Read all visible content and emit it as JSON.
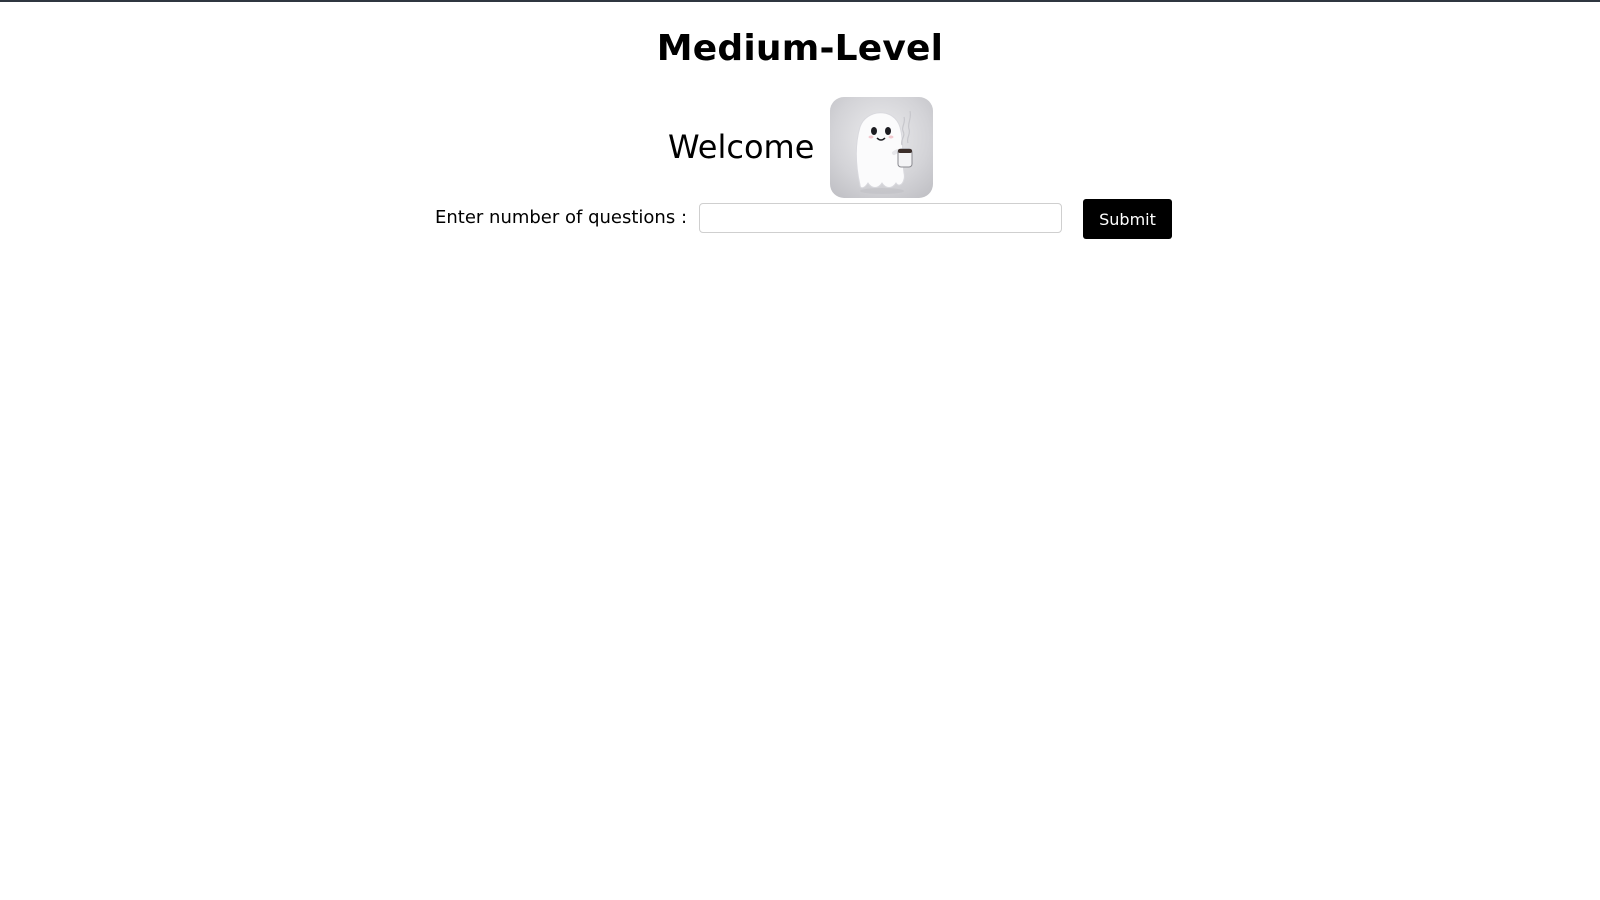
{
  "page": {
    "title": "Medium-Level",
    "welcome": "Welcome"
  },
  "avatar": {
    "icon": "ghost-holding-coffee-icon"
  },
  "form": {
    "label": "Enter number of questions :",
    "input_value": "",
    "input_placeholder": "",
    "submit_label": "Submit"
  },
  "colors": {
    "top_border": "#2f3640",
    "button_bg": "#000000",
    "button_text": "#ffffff"
  }
}
